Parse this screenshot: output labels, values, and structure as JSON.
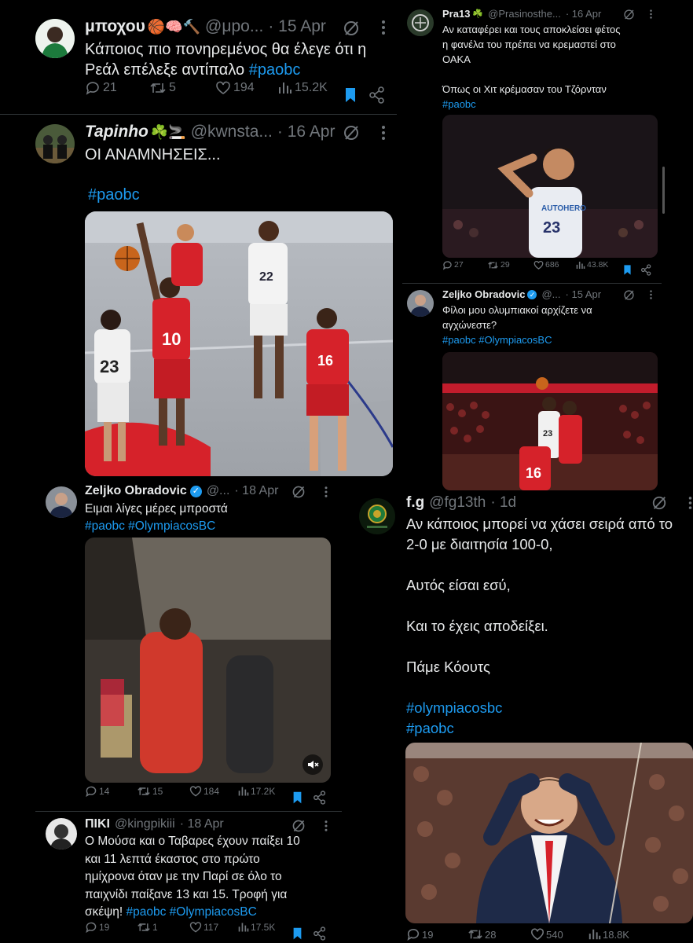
{
  "tweets": {
    "t1": {
      "name": "μποχου",
      "emoji": "🏀🧠🔨",
      "handle": "@μpo...",
      "date": "· 15 Apr",
      "lines": [
        "Κάποιος πιο πονηρεμένος θα έλεγε ότι η",
        "Ρεάλ επέλεξε αντίπαλο"
      ],
      "tag": "#paobc",
      "replies": "21",
      "retweets": "5",
      "likes": "194",
      "views": "15.2K"
    },
    "t2": {
      "name": "Tapinho",
      "emoji": "☘️🚬",
      "handle": "@kwnsta...",
      "date": "· 16 Apr",
      "lines": [
        "ΟΙ ΑΝΑΜΝΗΣΕΙΣ..."
      ],
      "tag": "#paobc",
      "jerseys": [
        "23",
        "10",
        "22",
        "16"
      ]
    },
    "t3": {
      "name": "Zeljko Obradovic",
      "handle": "@...",
      "date": "· 18 Apr",
      "lines": [
        "Ειμαι λίγες μέρες μπροστά"
      ],
      "tags": "#paobc #OlympiacosBC",
      "replies": "14",
      "retweets": "15",
      "likes": "184",
      "views": "17.2K"
    },
    "t4": {
      "name": "ΠΙΚΙ",
      "handle": "@kingpikiii",
      "date": "· 18 Apr",
      "lines": [
        "Ο Μούσα και ο Ταβαρες έχουν παίξει 10",
        "και 11 λεπτά έκαστος στο πρώτο",
        "ημίχρονα όταν με την Παρί σε όλο το",
        "παιχνίδι παίξανε 13 και 15. Τροφή για"
      ],
      "last_line": "σκέψη!",
      "tags": "#paobc #OlympiacosBC",
      "replies": "19",
      "retweets": "1",
      "likes": "117",
      "views": "17.5K"
    },
    "t5": {
      "name": "Pra13",
      "emoji": "☘️",
      "handle": "@Prasinosthe...",
      "date": "· 16 Apr",
      "lines": [
        "Αν καταφέρει και τους αποκλείσει φέτος",
        "η φανέλα του πρέπει να κρεμαστεί στο",
        "ΟΑΚΑ",
        "",
        "Όπως οι Χιτ κρέμασαν του Τζόρνταν"
      ],
      "tag": "#paobc",
      "jersey": "23",
      "sponsor": "AUTOHERO",
      "replies": "27",
      "retweets": "29",
      "likes": "686",
      "views": "43.8K"
    },
    "t6": {
      "name": "Zeljko Obradovic",
      "handle": "@...",
      "date": "· 15 Apr",
      "lines": [
        "Φίλοι μου ολυμπιακοί αρχίζετε να",
        "αγχώνεστε?"
      ],
      "tags": "#paobc #OlympiacosBC",
      "jerseys": [
        "23",
        "16"
      ]
    },
    "t7": {
      "name": "f.g",
      "handle": "@fg13th",
      "date": "· 1d",
      "lines": [
        "Αν κάποιος μπορεί να χάσει σειρά από το",
        "2-0 με διαιτησία 100-0,",
        "",
        "Αυτός είσαι εσύ,",
        "",
        "Και το έχεις αποδείξει.",
        "",
        "Πάμε Κόουτς",
        ""
      ],
      "tags": [
        "#olympiacosbc",
        "#paobc"
      ],
      "replies": "19",
      "retweets": "28",
      "likes": "540",
      "views": "18.8K"
    }
  },
  "colors": {
    "background": "#000000",
    "text": "#e7e9ea",
    "muted": "#71767b",
    "link": "#1d9bf0",
    "olympiacos_red": "#d6222a"
  }
}
